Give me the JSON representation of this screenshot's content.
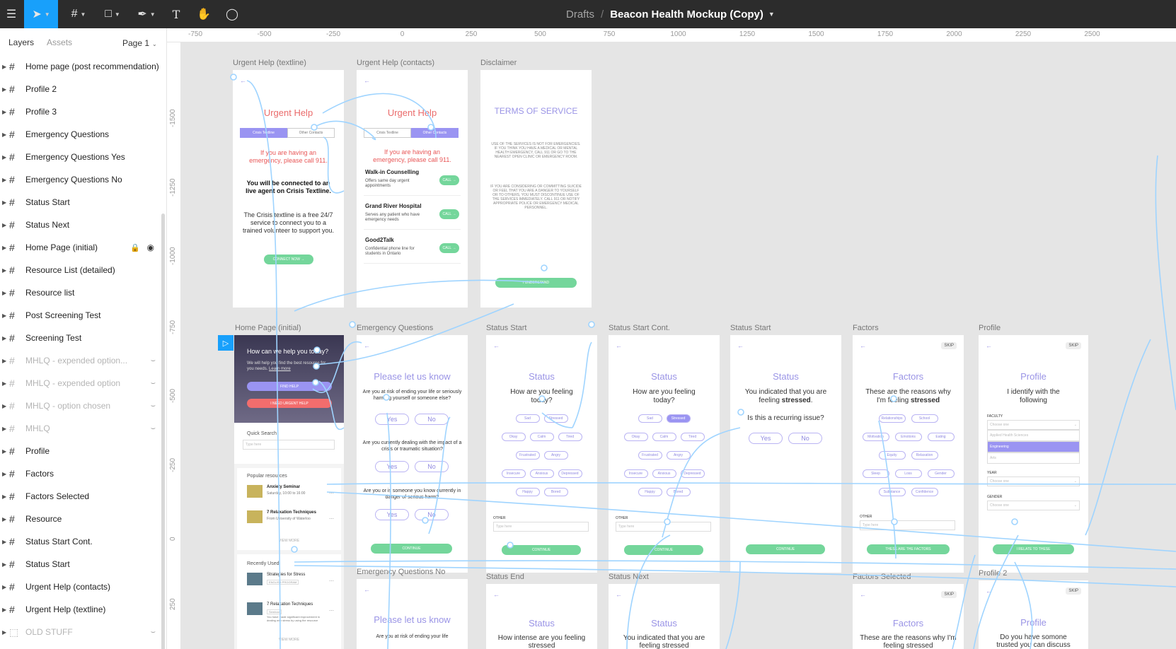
{
  "toolbar": {
    "breadcrumb_root": "Drafts",
    "breadcrumb_sep": "/",
    "file_title": "Beacon Health Mockup (Copy)",
    "tools": [
      "menu-icon",
      "move-icon",
      "frame-icon",
      "shape-icon",
      "pen-icon",
      "text-icon",
      "hand-icon",
      "comment-icon"
    ]
  },
  "panel": {
    "tab_layers": "Layers",
    "tab_assets": "Assets",
    "page": "Page 1",
    "layers": [
      {
        "label": "Home page (post recommendation)",
        "dim": false
      },
      {
        "label": "Profile 2",
        "dim": false
      },
      {
        "label": "Profile 3",
        "dim": false
      },
      {
        "label": "Emergency Questions",
        "dim": false
      },
      {
        "label": "Emergency Questions Yes",
        "dim": false
      },
      {
        "label": "Emergency Questions No",
        "dim": false
      },
      {
        "label": "Status Start",
        "dim": false
      },
      {
        "label": "Status Next",
        "dim": false
      },
      {
        "label": "Home Page (initial)",
        "dim": false,
        "locked": true
      },
      {
        "label": "Resource List (detailed)",
        "dim": false
      },
      {
        "label": "Resource list",
        "dim": false
      },
      {
        "label": "Post Screening Test",
        "dim": false
      },
      {
        "label": "Screening Test",
        "dim": false
      },
      {
        "label": "MHLQ - expended option...",
        "dim": true
      },
      {
        "label": "MHLQ - expended option",
        "dim": true
      },
      {
        "label": "MHLQ - option chosen",
        "dim": true
      },
      {
        "label": "MHLQ",
        "dim": true
      },
      {
        "label": "Profile",
        "dim": false
      },
      {
        "label": "Factors",
        "dim": false
      },
      {
        "label": "Factors Selected",
        "dim": false
      },
      {
        "label": "Resource",
        "dim": false
      },
      {
        "label": "Status Start Cont.",
        "dim": false
      },
      {
        "label": "Status Start",
        "dim": false
      },
      {
        "label": "Urgent Help (contacts)",
        "dim": false
      },
      {
        "label": "Urgent Help (textline)",
        "dim": false
      },
      {
        "label": "OLD STUFF",
        "dim": true,
        "section": true
      }
    ]
  },
  "rulers": {
    "h": [
      "-750",
      "-500",
      "-250",
      "0",
      "250",
      "500",
      "750",
      "1000",
      "1250",
      "1500",
      "1750",
      "2000",
      "2250",
      "2500"
    ],
    "v": [
      "-1500",
      "-1250",
      "-1000",
      "-750",
      "-500",
      "-250",
      "0",
      "250"
    ]
  },
  "frames": {
    "urgent_textline": {
      "label": "Urgent Help (textline)",
      "title": "Urgent Help",
      "tab_a": "Crisis Textline",
      "tab_b": "Other Contacts",
      "warn": "If you are having an emergency, please call 911.",
      "bold": "You will be connected to an live agent on Crisis Textline.",
      "body": "The Crisis textline is a free 24/7 service to connect you to a trained volunteer to support you.",
      "btn": "CONNECT NOW"
    },
    "urgent_contacts": {
      "label": "Urgent Help (contacts)",
      "title": "Urgent Help",
      "tab_a": "Crisis Textline",
      "tab_b": "Other Contacts",
      "warn": "If you are having an emergency, please call 911.",
      "contacts": [
        {
          "name": "Walk-in Counselling",
          "desc": "Offers same day urgent appointments"
        },
        {
          "name": "Grand River Hospital",
          "desc": "Serves any patient who have emergency needs"
        },
        {
          "name": "Good2Talk",
          "desc": "Confidential phone line for students in Ontario"
        }
      ],
      "call": "CALL"
    },
    "disclaimer": {
      "label": "Disclaimer",
      "title": "TERMS OF SERVICE",
      "p1": "USE OF THE SERVICES IS NOT FOR EMERGENCIES. IF YOU THINK YOU HAVE A MEDICAL OR MENTAL HEALTH EMERGENCY, CALL 911 OR GO TO THE NEAREST OPEN CLINIC OR EMERGENCY ROOM.",
      "p2": "IF YOU ARE CONSIDERING OR COMMITTING SUICIDE OR FEEL THAT YOU ARE A DANGER TO YOURSELF OR TO OTHERS, YOU MUST DISCONTINUE USE OF THE SERVICES IMMEDIATELY. CALL 911 OR NOTIFY APPROPRIATE POLICE OR EMERGENCY MEDICAL PERSONNEL.",
      "btn": "I UNDERSTAND"
    },
    "home": {
      "label": "Home Page (initial)",
      "question": "How can we help you today?",
      "sub": "We will help you find the best resource for you needs.",
      "learn": "Learn more",
      "btn_help": "FIND HELP",
      "btn_urgent": "I NEED URGENT HELP",
      "quick": "Quick Search",
      "search_ph": "Type here",
      "popular": "Popular resources",
      "res": [
        {
          "name": "Anxiety Seminar",
          "meta": "Saturday, 10:00 to 16:00"
        },
        {
          "name": "7 Relaxation Techniques",
          "meta": "From University of Waterloo"
        }
      ],
      "view_more": "VIEW MORE",
      "recent": "Recently Used",
      "recent_res": [
        {
          "name": "Strategies for Stress",
          "tag": "ENGLISH PROGRAM"
        },
        {
          "name": "7 Relaxation Techniques",
          "tag": "Seminar",
          "desc": "You have made significant improvement in dealing with stress by using the resource"
        }
      ]
    },
    "emergency": {
      "label": "Emergency Questions",
      "title": "Please let us know",
      "q1": "Are you at risk of ending your life or seriously harming yourself or someone else?",
      "q2": "Are you currently dealing with the impact of a crisis or traumatic situation?",
      "q3": "Are you or is someone you know currently in danger of serious harm?",
      "yes": "Yes",
      "no": "No",
      "btn": "CONTINUE"
    },
    "status_start": {
      "label": "Status Start",
      "title": "Status",
      "q": "How are you feeling today?",
      "moods": [
        "Sad",
        "Stressed",
        "Okay",
        "Calm",
        "Tired",
        "Frustrated",
        "Angry",
        "Insecure",
        "Anxious",
        "Depressed",
        "Happy",
        "Bored"
      ],
      "other": "OTHER",
      "other_ph": "Type here",
      "btn": "CONTINUE"
    },
    "status_cont": {
      "label": "Status Start Cont.",
      "title": "Status",
      "q": "How are you feeling today?",
      "moods": [
        "Sad",
        "Stressed",
        "Okay",
        "Calm",
        "Tired",
        "Frustrated",
        "Angry",
        "Insecure",
        "Anxious",
        "Depressed",
        "Happy",
        "Bored"
      ],
      "other": "OTHER",
      "other_ph": "Type here",
      "btn": "CONTINUE"
    },
    "status_start2": {
      "label": "Status Start",
      "title": "Status",
      "q_a": "You indicated that you are feeling",
      "q_b": "stressed",
      "q2": "Is this a recurring issue?",
      "yes": "Yes",
      "no": "No",
      "btn": "CONTINUE"
    },
    "factors": {
      "label": "Factors",
      "title": "Factors",
      "skip": "SKIP",
      "q_a": "These are the reasons why I'm feeling",
      "q_b": "stressed",
      "items": [
        "Relationships",
        "School",
        "Motivation",
        "Emotions",
        "Eating",
        "Equity",
        "Relaxation",
        "Sleep",
        "Loss",
        "Gender",
        "Substance",
        "Confidence"
      ],
      "other": "OTHER",
      "other_ph": "Type here",
      "btn": "THESE ARE THE FACTORS"
    },
    "profile": {
      "label": "Profile",
      "title": "Profile",
      "skip": "SKIP",
      "q": "I identify with the following",
      "faculty": "FACULTY",
      "choose": "Choose one",
      "options": [
        "Applied Health Sciences",
        "Engineering",
        "Arts"
      ],
      "year": "YEAR",
      "gender": "GENDER",
      "btn": "I RELATE TO THESE"
    },
    "emergency_no": {
      "label": "Emergency Questions No",
      "title": "Please let us know",
      "q1": "Are you at risk of ending your life"
    },
    "status_end": {
      "label": "Status End",
      "title": "Status",
      "q": "How intense are you feeling stressed"
    },
    "status_next": {
      "label": "Status Next",
      "title": "Status",
      "q": "You indicated that you are feeling stressed"
    },
    "factors_sel": {
      "label": "Factors Selected",
      "title": "Factors",
      "skip": "SKIP",
      "q": "These are the reasons why I'm feeling stressed"
    },
    "profile2": {
      "label": "Profile 2",
      "title": "Profile",
      "skip": "SKIP",
      "q": "Do you have somone trusted you can discuss"
    }
  },
  "colors": {
    "accent": "#18a0fb",
    "brand_purple": "#9a94f2",
    "green": "#74d69b",
    "red": "#ea6b6b",
    "connector": "#9fd4ff"
  }
}
